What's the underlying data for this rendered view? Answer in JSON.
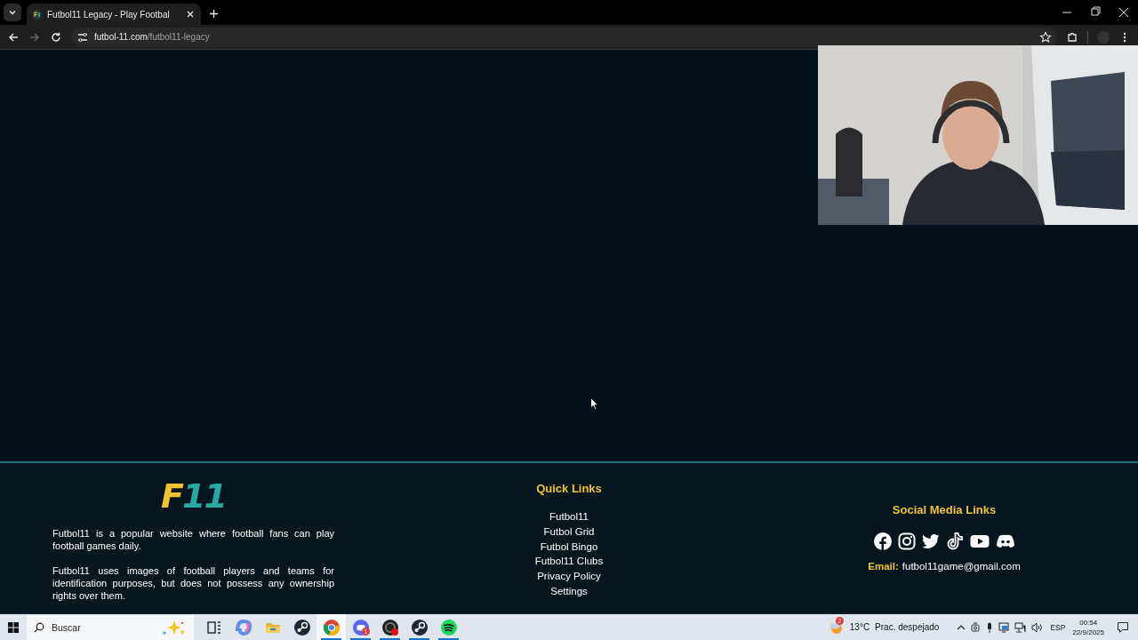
{
  "browser": {
    "tab": {
      "title": "Futbol11 Legacy - Play Footbal",
      "selected": true
    },
    "url": {
      "host": "futbol-11.com",
      "path": "/futbol11-legacy"
    }
  },
  "footer": {
    "logo": {
      "letter": "F",
      "digits": "11"
    },
    "about": [
      "Futbol11 is a popular website where football fans can play football games daily.",
      "Futbol11 uses images of football players and teams for identification purposes, but does not possess any ownership rights over them."
    ],
    "quick_links": {
      "title": "Quick Links",
      "items": [
        "Futbol11",
        "Futbol Grid",
        "Futbol Bingo",
        "Futbol11 Clubs",
        "Privacy Policy",
        "Settings"
      ]
    },
    "social": {
      "title": "Social Media Links",
      "email_label": "Email:",
      "email": "futbol11game@gmail.com"
    }
  },
  "taskbar": {
    "search_placeholder": "Buscar",
    "apps": [
      {
        "kind": "taskview",
        "running": false,
        "selected": false
      },
      {
        "kind": "swirl",
        "running": false,
        "selected": false
      },
      {
        "kind": "folder",
        "running": false,
        "selected": false
      },
      {
        "kind": "piston",
        "running": false,
        "selected": false
      },
      {
        "kind": "browser",
        "running": true,
        "selected": true
      },
      {
        "kind": "chat",
        "running": true,
        "selected": false,
        "badge": "1"
      },
      {
        "kind": "record",
        "running": true,
        "selected": false
      },
      {
        "kind": "piston",
        "running": true,
        "selected": false
      },
      {
        "kind": "music",
        "running": true,
        "selected": false
      }
    ],
    "weather": {
      "badge": "2",
      "temperature": "13°C",
      "condition": "Prac. despejado"
    },
    "language": "ESP",
    "time": "00:54",
    "date": "22/9/2025"
  }
}
